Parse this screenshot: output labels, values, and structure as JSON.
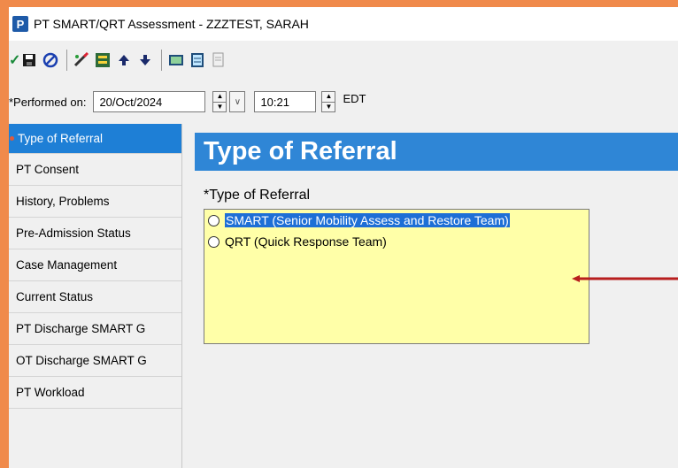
{
  "window": {
    "title": "PT SMART/QRT Assessment - ZZZTEST, SARAH",
    "app_icon_letter": "P"
  },
  "toolbar": {
    "icons": [
      "checkmark-icon",
      "save-icon",
      "cancel-icon",
      "edit-icon",
      "form-icon",
      "up-arrow-icon",
      "down-arrow-icon",
      "calculator-icon",
      "notes-icon",
      "document-icon"
    ]
  },
  "performed": {
    "label": "*Performed on:",
    "date": "20/Oct/2024",
    "time": "10:21",
    "timezone": "EDT"
  },
  "sidebar": {
    "items": [
      {
        "label": "Type of Referral",
        "active": true
      },
      {
        "label": "PT Consent"
      },
      {
        "label": "History, Problems"
      },
      {
        "label": "Pre-Admission Status"
      },
      {
        "label": "Case Management"
      },
      {
        "label": "Current Status"
      },
      {
        "label": "PT Discharge SMART G"
      },
      {
        "label": "OT Discharge SMART G"
      },
      {
        "label": "PT Workload"
      }
    ]
  },
  "main": {
    "banner": "Type of Referral",
    "field_label": "*Type of Referral",
    "options": [
      "SMART (Senior Mobility Assess and Restore Team)",
      "QRT (Quick Response Team)"
    ]
  },
  "colors": {
    "banner": "#2f86d6",
    "active_item": "#1e7fd6",
    "radio_box": "#ffffa8",
    "arrow": "#b81e1e",
    "frame": "#f08a4b"
  }
}
